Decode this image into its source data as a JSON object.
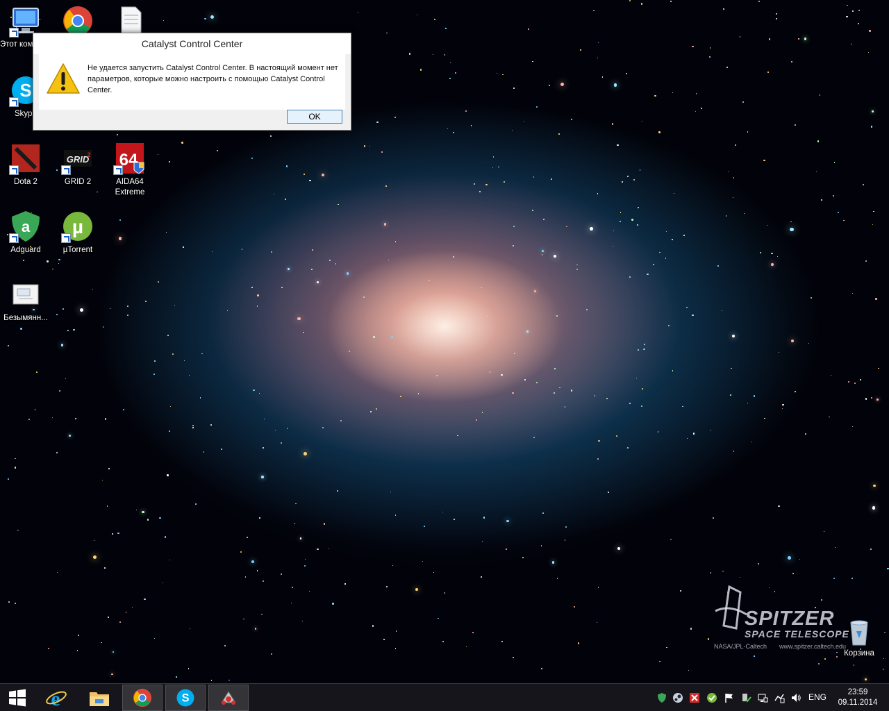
{
  "desktop": {
    "icons": [
      {
        "label": "Этот компьютер",
        "icon": "this-pc-icon"
      },
      {
        "label": "",
        "icon": "chrome-icon"
      },
      {
        "label": "",
        "icon": "text-document-icon"
      },
      {
        "label": "Skype",
        "icon": "skype-icon"
      },
      {
        "label": "Dota 2",
        "icon": "dota2-icon"
      },
      {
        "label": "GRID 2",
        "icon": "grid2-icon"
      },
      {
        "label": "AIDA64 Extreme",
        "icon": "aida64-icon"
      },
      {
        "label": "Adguard",
        "icon": "adguard-icon"
      },
      {
        "label": "µTorrent",
        "icon": "utorrent-icon"
      },
      {
        "label": "Безымянн...",
        "icon": "image-file-icon"
      }
    ],
    "recycle_bin": {
      "label": "Корзина",
      "icon": "recycle-bin-icon"
    }
  },
  "wallpaper": {
    "brand_main": "SPITZER",
    "brand_sub": "SPACE TELESCOPE",
    "credit": "NASA/JPL-Caltech",
    "url": "www.spitzer.caltech.edu"
  },
  "dialog": {
    "title": "Catalyst Control Center",
    "message": "Не удается запустить Catalyst Control Center. В настоящий момент нет параметров, которые можно настроить с помощью Catalyst Control Center.",
    "ok_label": "OK",
    "icon": "warning-icon"
  },
  "taskbar": {
    "buttons": [
      {
        "icon": "windows-start-icon"
      },
      {
        "icon": "internet-explorer-icon"
      },
      {
        "icon": "file-explorer-icon"
      },
      {
        "icon": "chrome-icon"
      },
      {
        "icon": "skype-icon"
      },
      {
        "icon": "catalyst-icon"
      }
    ],
    "tray": {
      "icons": [
        "adguard-tray-icon",
        "steam-tray-icon",
        "kaspersky-tray-icon",
        "utorrent-tray-icon",
        "action-center-flag-icon",
        "safely-remove-icon",
        "network-icon",
        "power-icon",
        "volume-icon"
      ],
      "language": "ENG",
      "time": "23:59",
      "date": "09.11.2014"
    }
  },
  "colors": {
    "taskbar_bg": "#16161c",
    "dialog_bg": "#f0f0f0",
    "ok_button_border": "#3c7fb1",
    "warning_yellow": "#f5c211"
  }
}
